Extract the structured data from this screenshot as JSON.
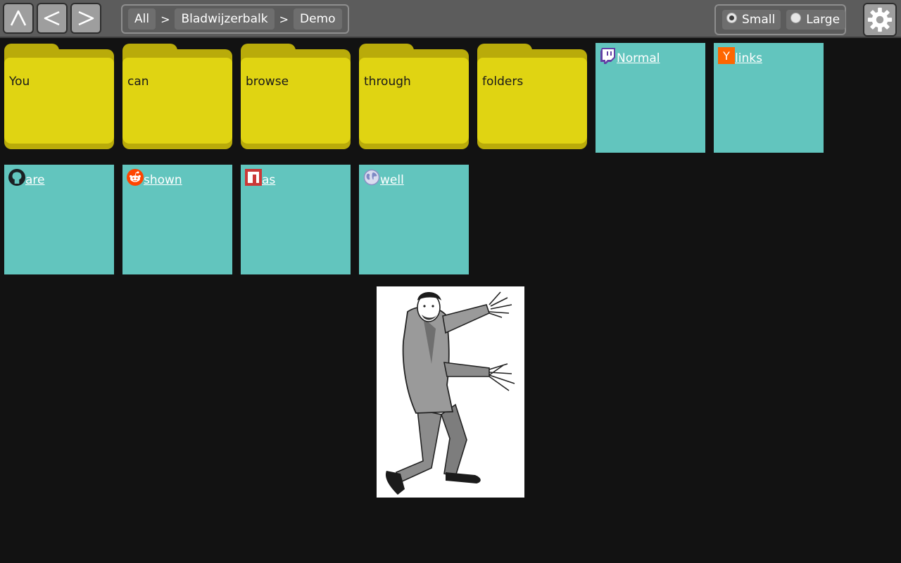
{
  "nav": {
    "up_icon": "caret-up-icon",
    "back_icon": "chevron-left-icon",
    "forward_icon": "chevron-right-icon",
    "breadcrumb": [
      "All",
      "Bladwijzerbalk",
      "Demo"
    ],
    "breadcrumb_separator": ">"
  },
  "size_options": {
    "small_label": "Small",
    "large_label": "Large",
    "selected": "Small"
  },
  "settings_icon": "gear-icon",
  "folders": [
    {
      "label": "You"
    },
    {
      "label": "can"
    },
    {
      "label": "browse"
    },
    {
      "label": "through"
    },
    {
      "label": "folders"
    }
  ],
  "links": [
    {
      "label": "Normal",
      "icon": "twitch-icon"
    },
    {
      "label": "links",
      "icon": "hacker-news-icon"
    },
    {
      "label": "are",
      "icon": "github-icon"
    },
    {
      "label": "shown",
      "icon": "reddit-icon"
    },
    {
      "label": "as",
      "icon": "npm-icon"
    },
    {
      "label": "well",
      "icon": "globe-icon"
    }
  ],
  "colors": {
    "background": "#121212",
    "topbar": "#5c5c5c",
    "folder": "#e0d412",
    "folder_tab": "#b9ab0a",
    "link_tile": "#62c5be"
  },
  "background_image": "dancing-man-illustration"
}
